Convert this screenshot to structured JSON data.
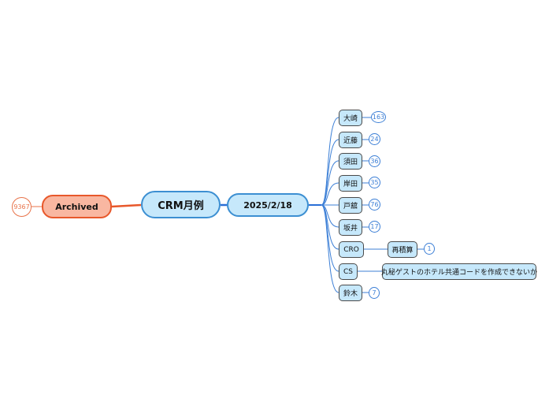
{
  "colors": {
    "blue_fill": "#c6e8fb",
    "blue_border": "#3c8fd2",
    "blue_line": "#2a6fd6",
    "orange_fill": "#f9b7a1",
    "orange_border": "#e8582b",
    "badge_blue": "#3c7fd6",
    "badge_orange": "#e8734a"
  },
  "central_topic": "CRM月例",
  "archived": {
    "label": "Archived",
    "count": "9367"
  },
  "date_topic": "2025/2/18",
  "members": [
    {
      "name": "大崎",
      "count": "163"
    },
    {
      "name": "近藤",
      "count": "24"
    },
    {
      "name": "須田",
      "count": "36"
    },
    {
      "name": "岸田",
      "count": "35"
    },
    {
      "name": "戸舘",
      "count": "76"
    },
    {
      "name": "坂井",
      "count": "17"
    },
    {
      "name": "CRO",
      "child": {
        "label": "再積算",
        "count": "1"
      }
    },
    {
      "name": "CS",
      "child": {
        "label": "丸秘ゲストのホテル共通コードを作成できないか"
      }
    },
    {
      "name": "鈴木",
      "count": "7"
    }
  ]
}
